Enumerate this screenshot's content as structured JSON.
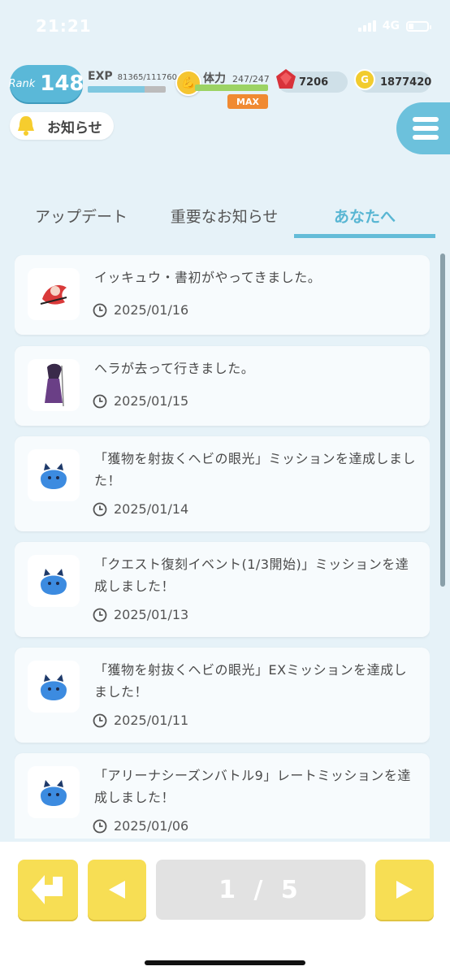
{
  "status_bar": {
    "time": "21:21",
    "network": "4G"
  },
  "hud": {
    "rank_label": "Rank",
    "rank_value": "148",
    "exp_label": "EXP",
    "exp_value": "81365/111760",
    "exp_progress": 0.73,
    "stamina_label": "体力",
    "stamina_value": "247/247",
    "stamina_progress": 1.0,
    "stamina_badge": "MAX",
    "gems": "7206",
    "coins": "1877420",
    "coin_symbol": "G"
  },
  "header": {
    "title": "お知らせ"
  },
  "tabs": [
    {
      "label": "アップデート",
      "active": false
    },
    {
      "label": "重要なお知らせ",
      "active": false
    },
    {
      "label": "あなたへ",
      "active": true
    }
  ],
  "notifications": [
    {
      "icon": "character-icon-red",
      "text": "イッキュウ・書初がやってきました。",
      "date": "2025/01/16"
    },
    {
      "icon": "character-icon-purple",
      "text": "ヘラが去って行きました。",
      "date": "2025/01/15"
    },
    {
      "icon": "mascot-icon-blue",
      "text": "「獲物を射抜くヘビの眼光」ミッションを達成しました！",
      "date": "2025/01/14"
    },
    {
      "icon": "mascot-icon-blue",
      "text": "「クエスト復刻イベント(1/3開始)」ミッションを達成しました！",
      "date": "2025/01/13"
    },
    {
      "icon": "mascot-icon-blue",
      "text": "「獲物を射抜くヘビの眼光」EXミッションを達成しました！",
      "date": "2025/01/11"
    },
    {
      "icon": "mascot-icon-blue",
      "text": "「アリーナシーズンバトル9」レートミッションを達成しました！",
      "date": "2025/01/06"
    }
  ],
  "pagination": {
    "label": "1 / 5"
  },
  "colors": {
    "accent": "#58b6d3",
    "button_yellow": "#f7de54",
    "background": "#e6f2f8"
  }
}
